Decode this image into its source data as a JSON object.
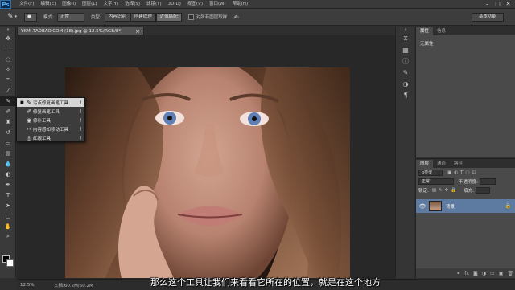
{
  "app": {
    "logo": "Ps",
    "menus": [
      "文件(F)",
      "编辑(E)",
      "图像(I)",
      "图层(L)",
      "文字(Y)",
      "选择(S)",
      "滤镜(T)",
      "3D(D)",
      "视图(V)",
      "窗口(W)",
      "帮助(H)"
    ],
    "window_controls": [
      "–",
      "□",
      "✕"
    ]
  },
  "options": {
    "mode_label": "模式:",
    "mode_value": "正常",
    "type_label": "类型:",
    "type_buttons": [
      "内容识别",
      "创建纹理",
      "近似匹配"
    ],
    "sample_all_layers": "对所有图层取样",
    "workspace": "基本功能"
  },
  "document": {
    "tab_title": "YKMI.TAOBAO.COM (18).jpg @ 12.5%(RGB/8*)",
    "zoom": "12.5%",
    "doc_size": "文档:60.2M/60.2M"
  },
  "flyout": {
    "items": [
      {
        "label": "污点修复画笔工具",
        "key": "J",
        "icon": "✎",
        "selected": true
      },
      {
        "label": "修复画笔工具",
        "key": "J",
        "icon": "✐",
        "selected": false
      },
      {
        "label": "修补工具",
        "key": "J",
        "icon": "◉",
        "selected": false
      },
      {
        "label": "内容感知移动工具",
        "key": "J",
        "icon": "✂",
        "selected": false
      },
      {
        "label": "红眼工具",
        "key": "J",
        "icon": "◎",
        "selected": false
      }
    ]
  },
  "properties": {
    "tabs": [
      "属性",
      "信息"
    ],
    "body": "无属性"
  },
  "layers": {
    "tabs": [
      "图层",
      "通道",
      "路径"
    ],
    "kind_label": "ρ类型",
    "blend_mode": "正常",
    "opacity_label": "不透明度:",
    "lock_label": "锁定:",
    "fill_label": "填充:",
    "layer_name": "背景"
  },
  "subtitle": "那么这个工具让我们来看看它所在的位置，就是在这个地方"
}
